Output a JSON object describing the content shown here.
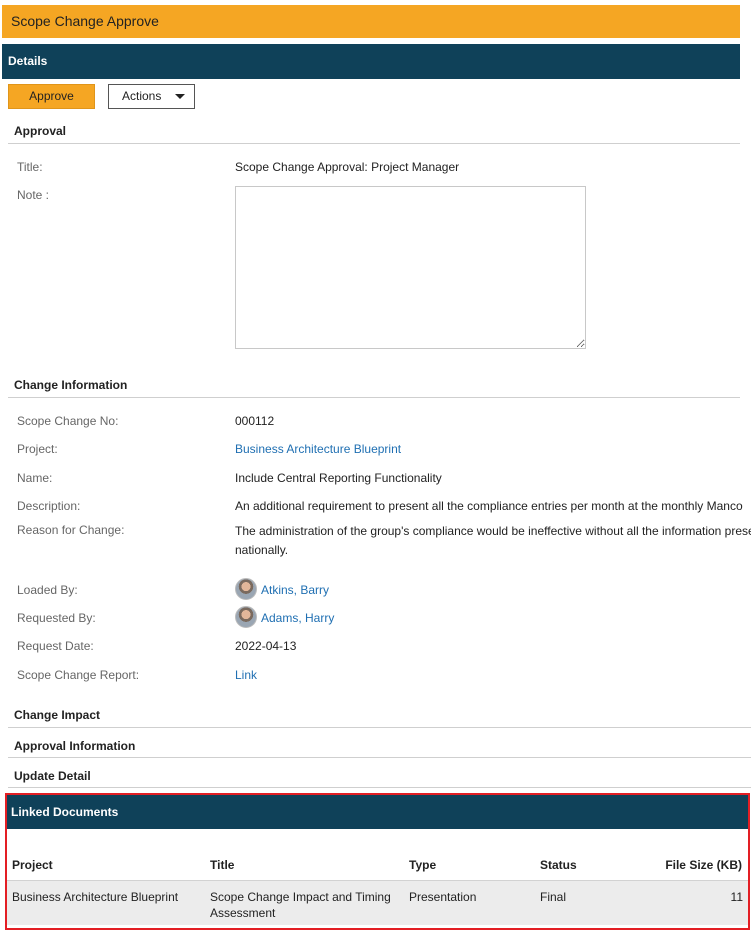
{
  "page_title": "Scope Change Approve",
  "details_header": "Details",
  "toolbar": {
    "approve_label": "Approve",
    "actions_label": "Actions"
  },
  "approval": {
    "section_title": "Approval",
    "title_label": "Title:",
    "title_value": "Scope Change Approval: Project Manager",
    "note_label": "Note :",
    "note_value": ""
  },
  "change_info": {
    "section_title": "Change Information",
    "fields": {
      "scope_change_no": {
        "label": "Scope Change No:",
        "value": "000112"
      },
      "project": {
        "label": "Project:",
        "value": "Business Architecture Blueprint"
      },
      "name": {
        "label": "Name:",
        "value": "Include Central Reporting Functionality"
      },
      "description": {
        "label": "Description:",
        "value": "An additional requirement to present all the compliance entries per month at the monthly Manco"
      },
      "reason": {
        "label": "Reason for Change:",
        "value_line1": "The administration of the group's compliance would be ineffective without all the information presen",
        "value_line2": "nationally."
      },
      "loaded_by": {
        "label": "Loaded By:",
        "value": "Atkins, Barry"
      },
      "requested_by": {
        "label": "Requested By:",
        "value": "Adams, Harry"
      },
      "request_date": {
        "label": "Request Date:",
        "value": "2022-04-13"
      },
      "report": {
        "label": "Scope Change Report:",
        "value": "Link"
      }
    }
  },
  "collapsed_sections": [
    "Change Impact",
    "Approval Information",
    "Update Detail"
  ],
  "linked_documents": {
    "title": "Linked Documents",
    "columns": [
      "Project",
      "Title",
      "Type",
      "Status",
      "File Size (KB)"
    ],
    "rows": [
      {
        "project": "Business Architecture Blueprint",
        "title_line1": "Scope Change Impact and Timing",
        "title_line2": "Assessment",
        "type": "Presentation",
        "status": "Final",
        "size": "11"
      }
    ]
  }
}
